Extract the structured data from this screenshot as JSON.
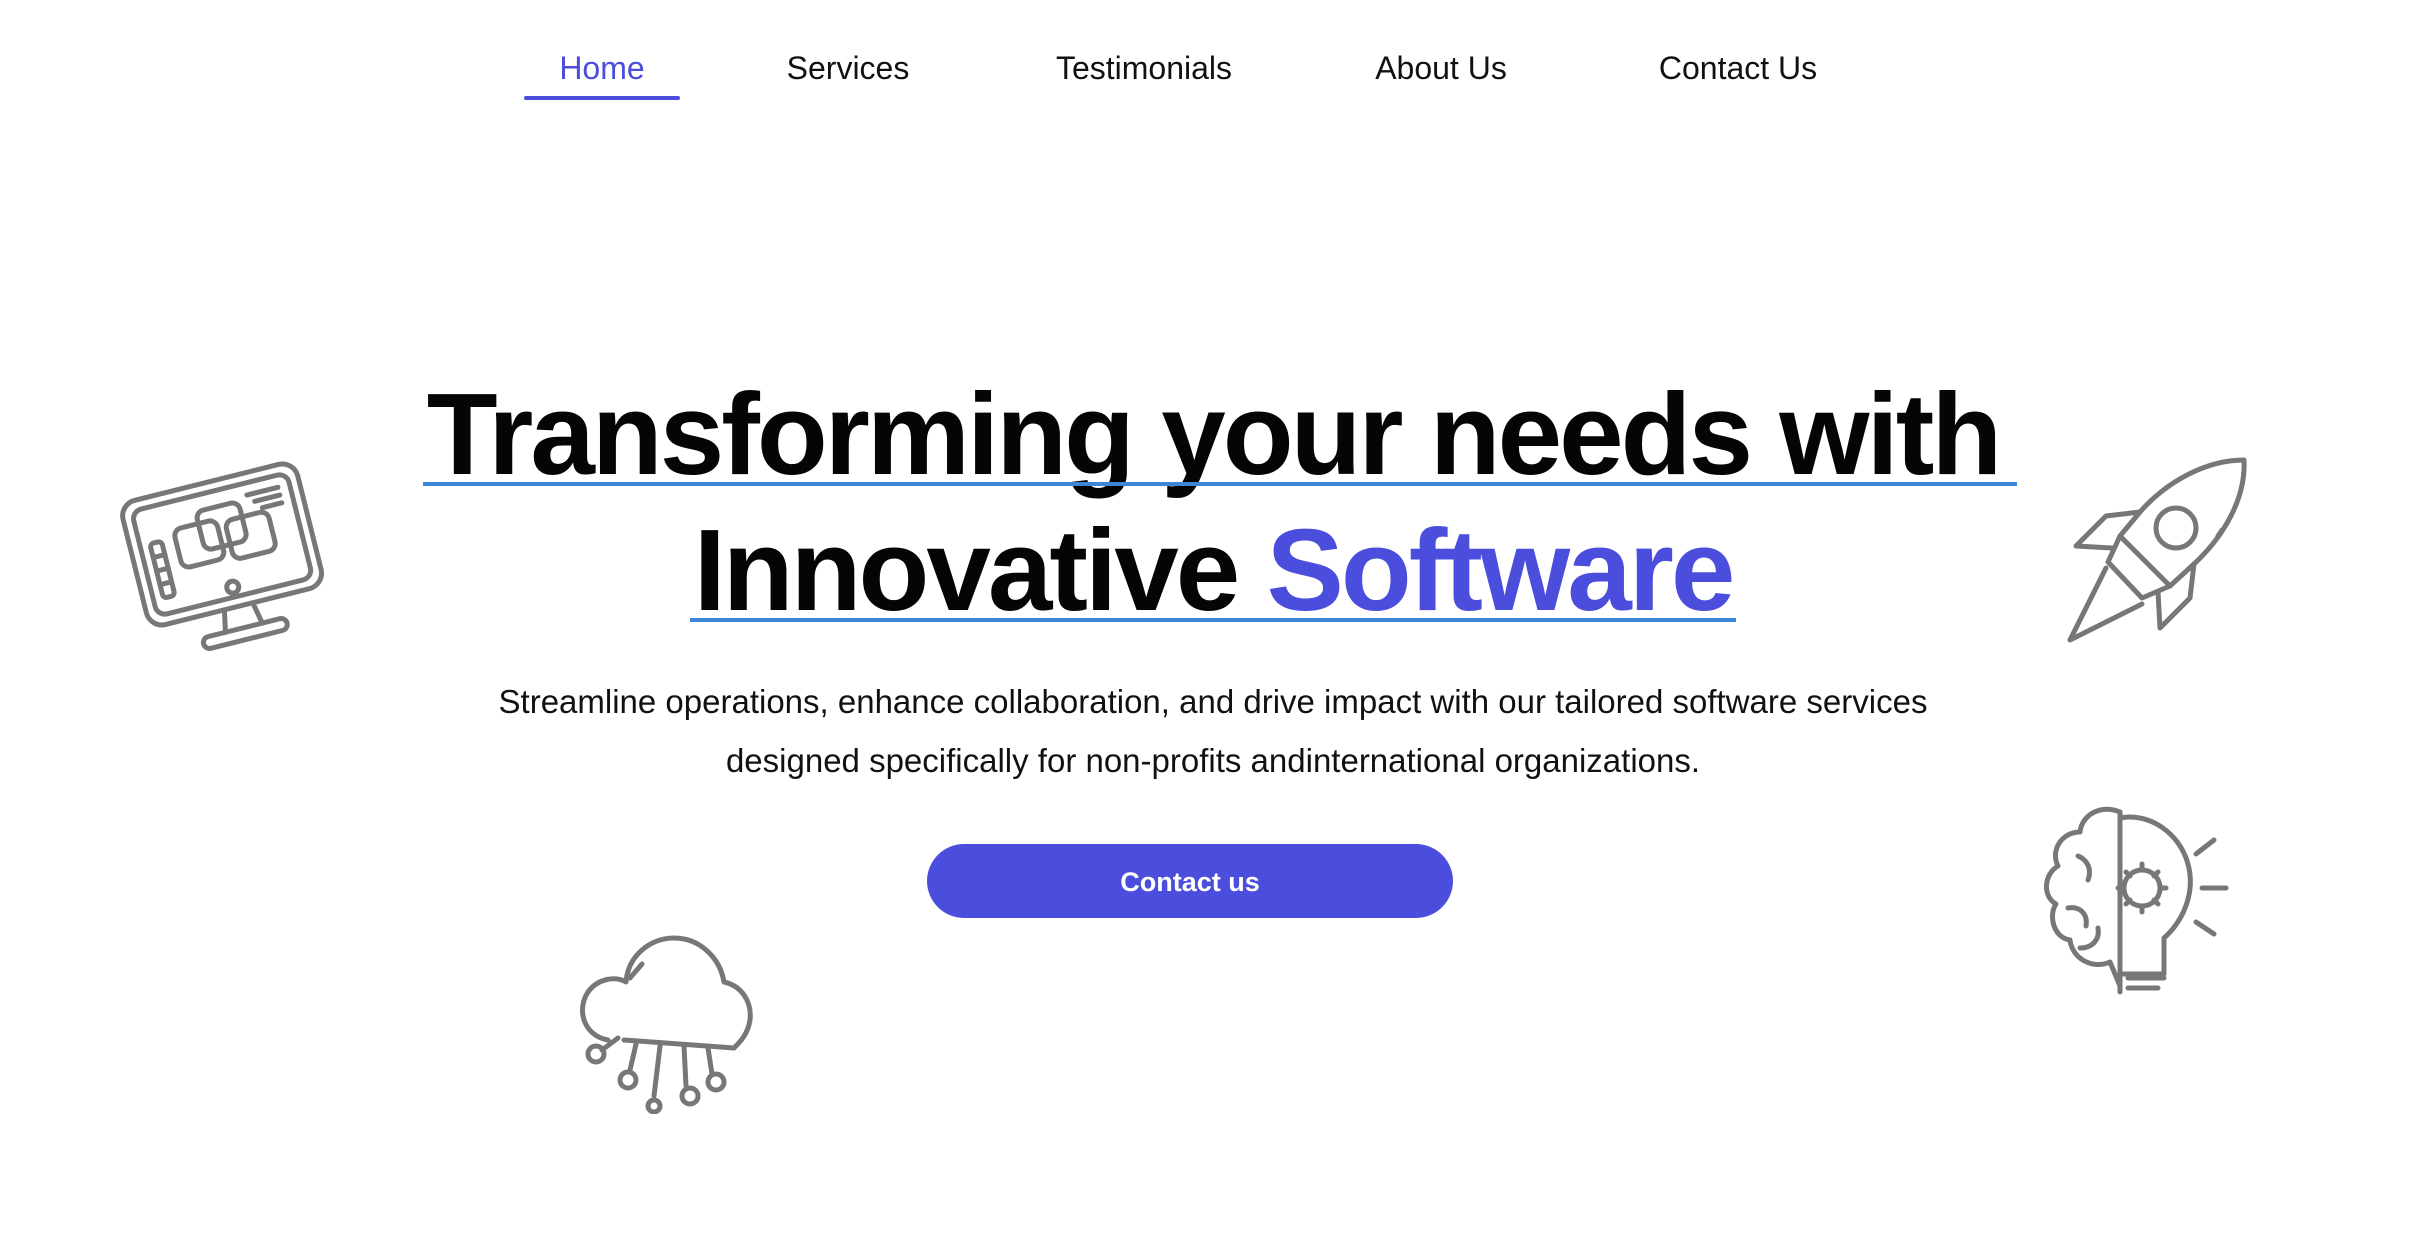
{
  "nav": {
    "items": [
      {
        "label": "Home",
        "active": true
      },
      {
        "label": "Services",
        "active": false
      },
      {
        "label": "Testimonials",
        "active": false
      },
      {
        "label": "About Us",
        "active": false
      },
      {
        "label": "Contact Us",
        "active": false
      }
    ]
  },
  "hero": {
    "title_line1": "Transforming your needs with",
    "title_line2_prefix": "Innovative",
    "title_line2_accent": "Software",
    "subtitle_line1": "Streamline operations, enhance collaboration, and drive impact with our tailored software services",
    "subtitle_line2": "designed specifically for non-profits andinternational organizations.",
    "cta_label": "Contact us"
  },
  "icons": {
    "monitor": "monitor-design-icon",
    "rocket": "rocket-icon",
    "cloud": "cloud-network-icon",
    "brain": "brain-gear-icon"
  },
  "colors": {
    "accent": "#4b4ddc",
    "underline": "#3d87d8",
    "icon_stroke": "#777777",
    "text": "#050505"
  }
}
